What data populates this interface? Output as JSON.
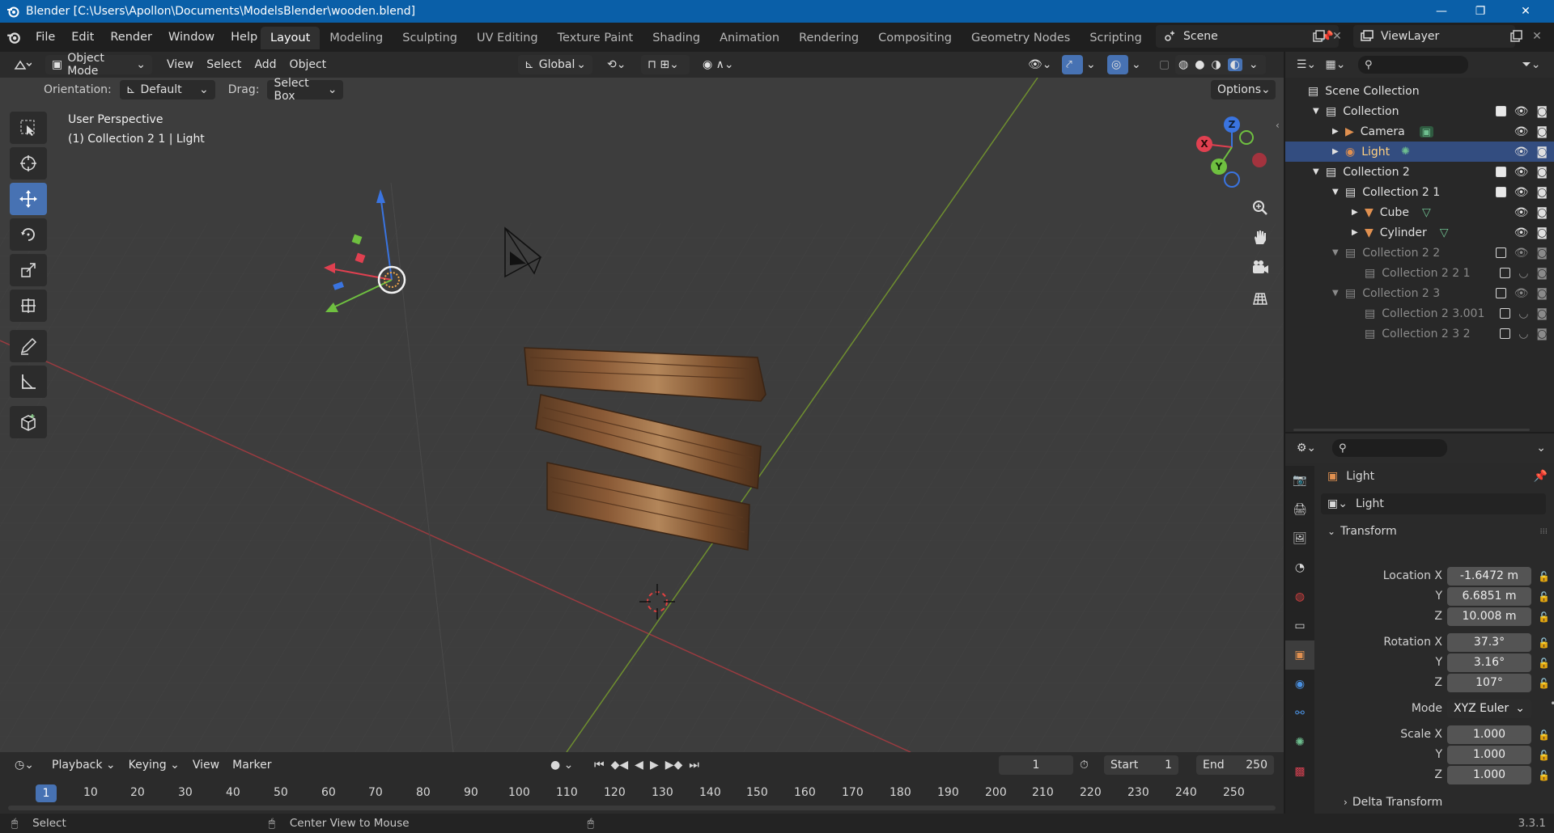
{
  "window": {
    "title": "Blender [C:\\Users\\Apollon\\Documents\\ModelsBlender\\wooden.blend]"
  },
  "menu": [
    "File",
    "Edit",
    "Render",
    "Window",
    "Help"
  ],
  "workspaces": [
    "Layout",
    "Modeling",
    "Sculpting",
    "UV Editing",
    "Texture Paint",
    "Shading",
    "Animation",
    "Rendering",
    "Compositing",
    "Geometry Nodes",
    "Scripting"
  ],
  "scene": {
    "name": "Scene",
    "view_layer": "ViewLayer"
  },
  "viewport": {
    "mode": "Object Mode",
    "menus": [
      "View",
      "Select",
      "Add",
      "Object"
    ],
    "transform_orientation": "Global",
    "orientation_label": "Orientation:",
    "orientation_value": "Default",
    "drag_label": "Drag:",
    "drag_value": "Select Box",
    "options_label": "Options",
    "perspective": "User Perspective",
    "context": "(1) Collection 2 1 | Light",
    "gizmo_x": "X",
    "gizmo_y": "Y",
    "gizmo_z": "Z"
  },
  "outliner": {
    "root": "Scene Collection",
    "rows": [
      {
        "label": "Collection",
        "indent": 1,
        "icon": "collection-icon"
      },
      {
        "label": "Camera",
        "indent": 2,
        "icon": "camera-icon"
      },
      {
        "label": "Light",
        "indent": 2,
        "icon": "light-icon"
      },
      {
        "label": "Collection 2",
        "indent": 1,
        "icon": "collection-icon"
      },
      {
        "label": "Collection 2 1",
        "indent": 2,
        "icon": "collection-icon"
      },
      {
        "label": "Cube",
        "indent": 3,
        "icon": "mesh-icon"
      },
      {
        "label": "Cylinder",
        "indent": 3,
        "icon": "mesh-icon"
      },
      {
        "label": "Collection 2 2",
        "indent": 2,
        "icon": "collection-icon"
      },
      {
        "label": "Collection 2 2 1",
        "indent": 3,
        "icon": "collection-icon"
      },
      {
        "label": "Collection 2 3",
        "indent": 2,
        "icon": "collection-icon"
      },
      {
        "label": "Collection 2 3.001",
        "indent": 3,
        "icon": "collection-icon"
      },
      {
        "label": "Collection 2 3 2",
        "indent": 3,
        "icon": "collection-icon"
      }
    ]
  },
  "properties": {
    "object_name": "Light",
    "object_field": "Light",
    "transform_label": "Transform",
    "location_label": "Location X",
    "rotation_label": "Rotation X",
    "scale_label": "Scale X",
    "y_label": "Y",
    "z_label": "Z",
    "location": [
      "-1.6472 m",
      "6.6851 m",
      "10.008 m"
    ],
    "rotation": [
      "37.3°",
      "3.16°",
      "107°"
    ],
    "mode_label": "Mode",
    "mode_value": "XYZ Euler",
    "scale": [
      "1.000",
      "1.000",
      "1.000"
    ],
    "delta_transform": "Delta Transform"
  },
  "timeline": {
    "menus": [
      "Playback",
      "Keying",
      "View",
      "Marker"
    ],
    "current_frame": "1",
    "start_label": "Start",
    "start": "1",
    "end_label": "End",
    "end": "250",
    "ticks": [
      "1",
      "10",
      "20",
      "30",
      "40",
      "50",
      "60",
      "70",
      "80",
      "90",
      "100",
      "110",
      "120",
      "130",
      "140",
      "150",
      "160",
      "170",
      "180",
      "190",
      "200",
      "210",
      "220",
      "230",
      "240",
      "250"
    ]
  },
  "status": {
    "select": "Select",
    "center_view": "Center View to Mouse",
    "version": "3.3.1"
  }
}
